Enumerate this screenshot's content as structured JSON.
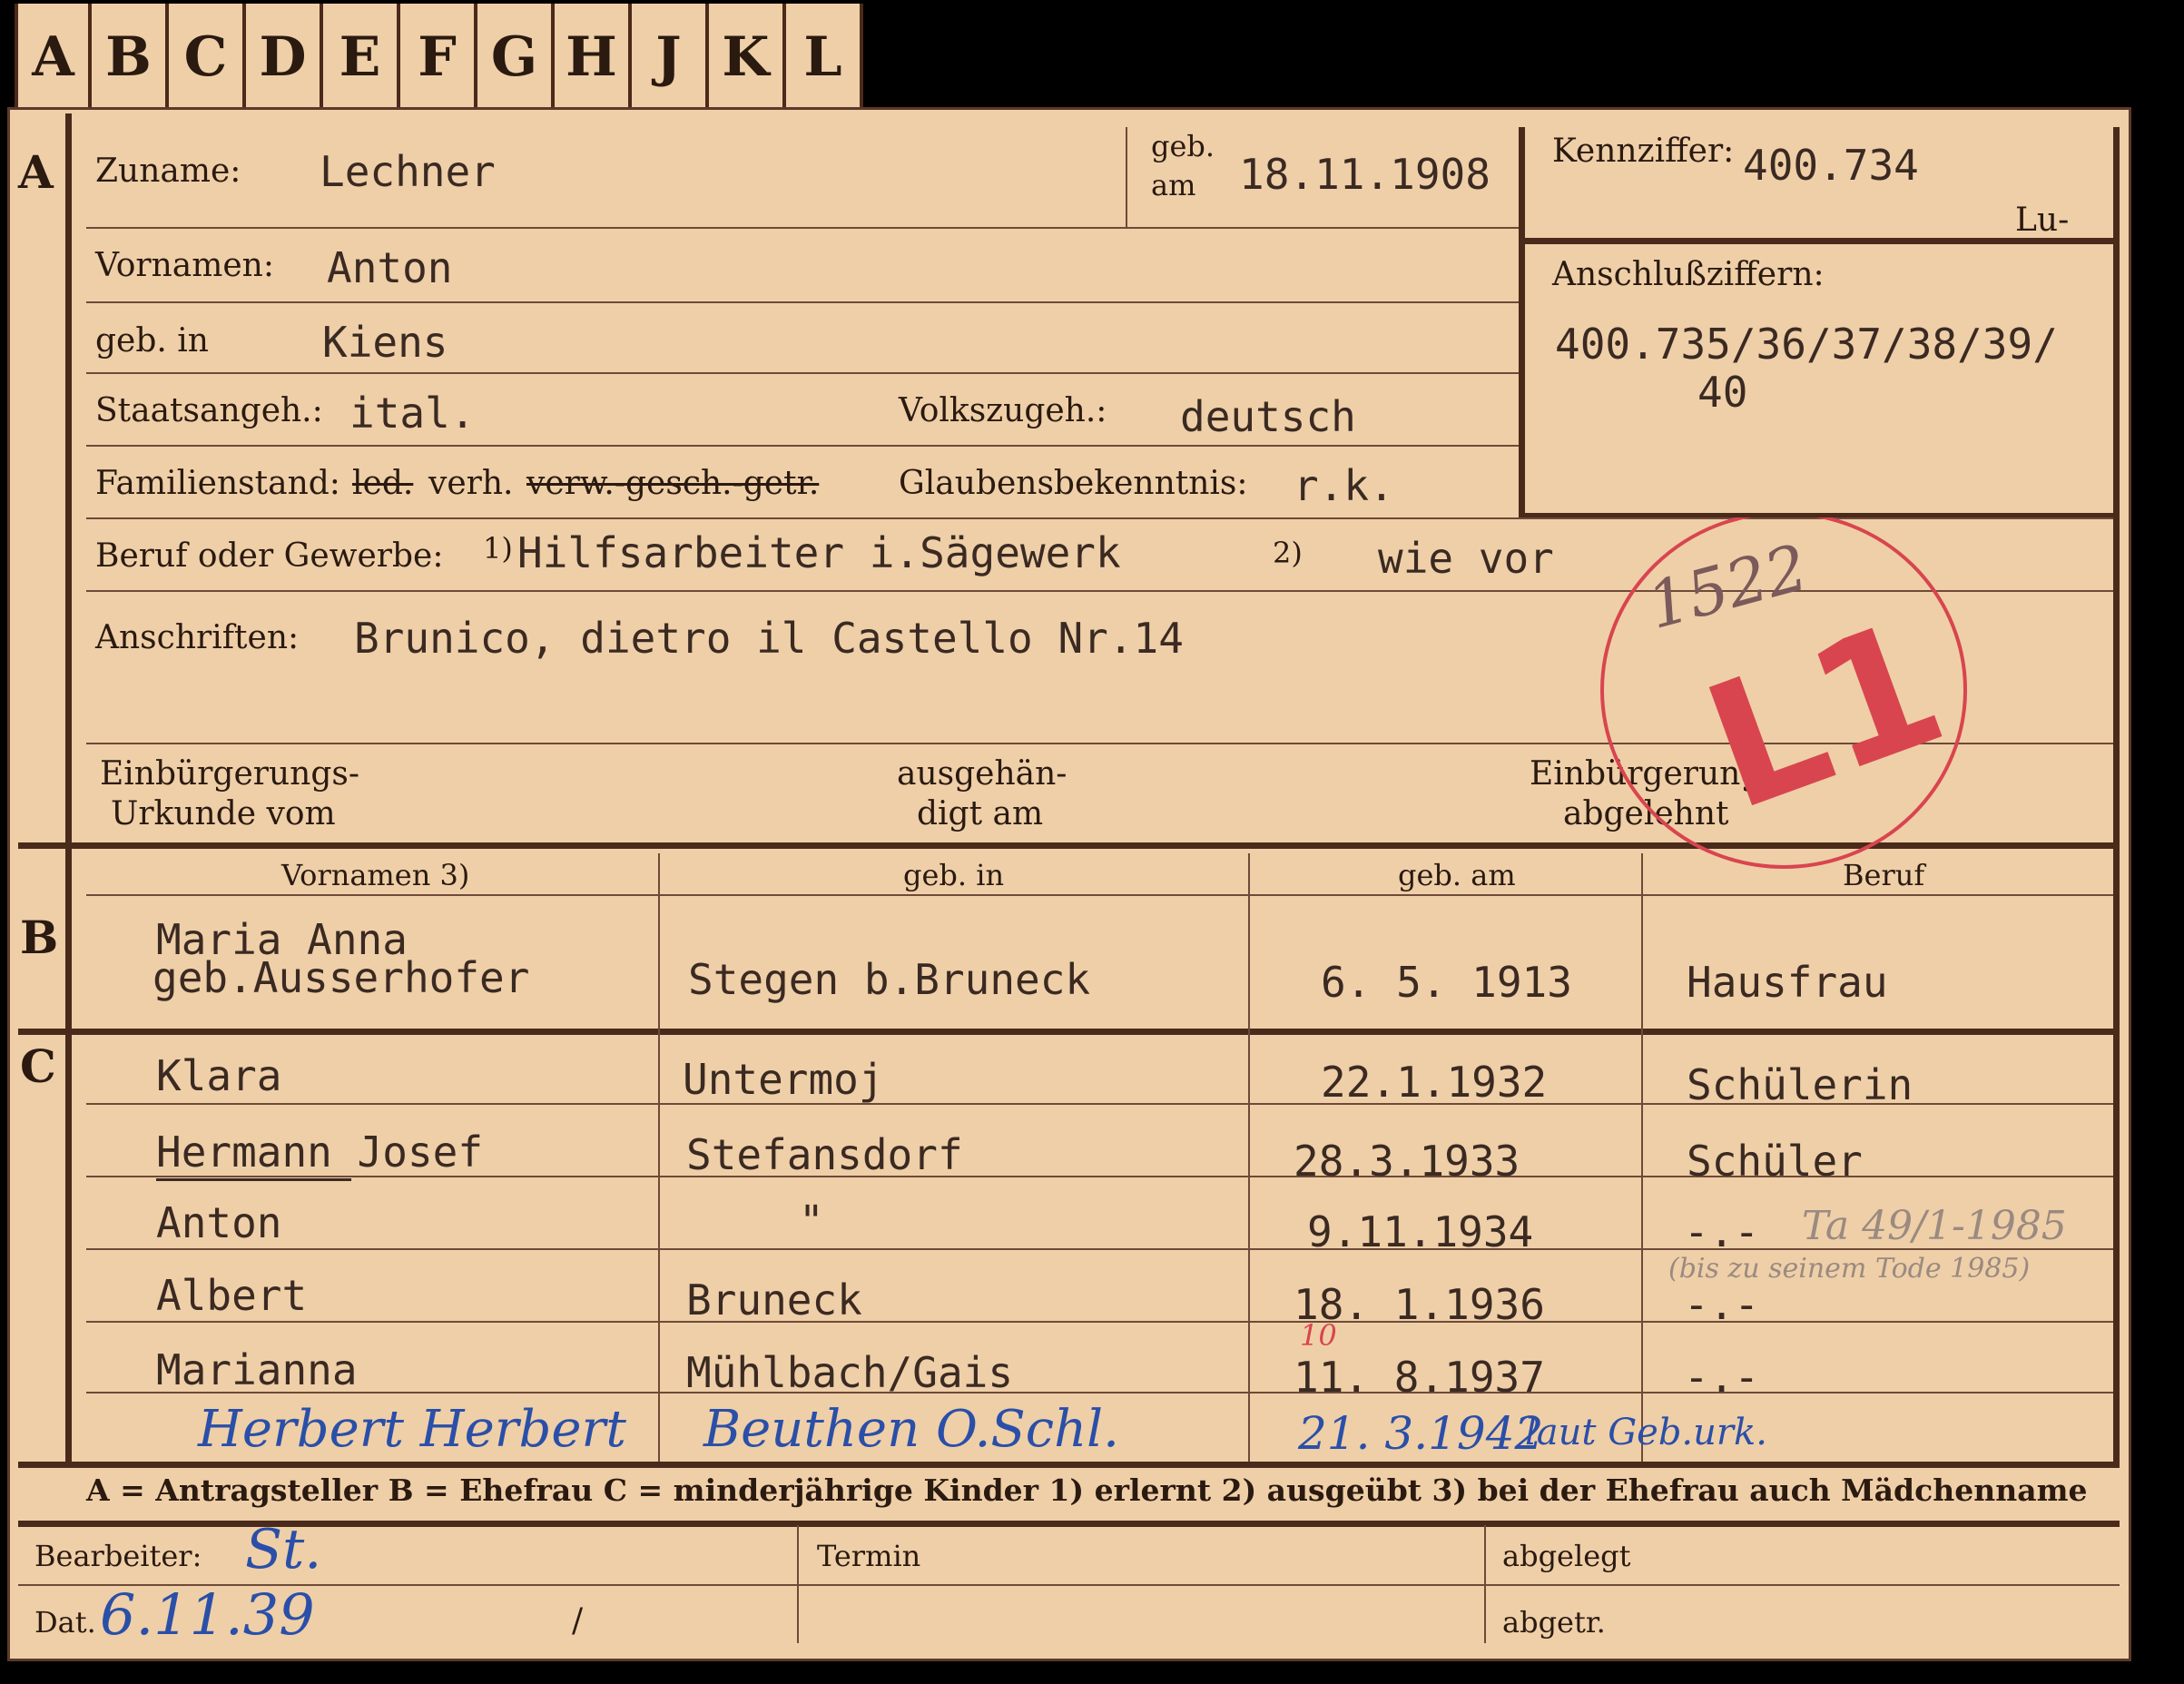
{
  "tabs": [
    "A",
    "B",
    "C",
    "D",
    "E",
    "F",
    "G",
    "H",
    "J",
    "K",
    "L"
  ],
  "sections": {
    "a": "A",
    "b": "B",
    "c": "C"
  },
  "header": {
    "zuname_label": "Zuname:",
    "zuname": "Lechner",
    "geb_label_1": "geb.",
    "geb_label_2": "am",
    "geb_am": "18.11.1908",
    "kennziffer_label": "Kennziffer:",
    "kennziffer": "400.734",
    "kennziffer_note": "Lu-",
    "anschluss_label": "Anschlußziffern:",
    "anschluss_1": "400.735/36/37/38/39/",
    "anschluss_2": "40",
    "vornamen_label": "Vornamen:",
    "vornamen": "Anton",
    "gebin_label": "geb. in",
    "gebin": "Kiens",
    "staat_label": "Staatsangeh.:",
    "staat": "ital.",
    "volk_label": "Volkszugeh.:",
    "volk": "deutsch",
    "fam_label": "Familienstand:",
    "fam_led": "led.",
    "fam_verh": "verh.",
    "fam_rest": "verw.-gesch.-getr.",
    "glaub_label": "Glaubensbekenntnis:",
    "glaub": "r.k.",
    "beruf_label": "Beruf oder Gewerbe:",
    "fn1": "1)",
    "beruf1": "Hilfsarbeiter i.Sägewerk",
    "fn2": "2)",
    "beruf2": "wie vor",
    "anschrift_label": "Anschriften:",
    "anschrift": "Brunico, dietro il Castello Nr.14",
    "einb1a": "Einbürgerungs-",
    "einb1b": "Urkunde vom",
    "ausg1": "ausgehän-",
    "ausg2": "digt am",
    "einb2a": "Einbürgerung",
    "einb2b": "abgelehnt"
  },
  "stamp": {
    "number": "1522",
    "code": "L1",
    "color": "#d8454f"
  },
  "spouse": {
    "headers": [
      "Vornamen 3)",
      "geb. in",
      "geb. am",
      "Beruf"
    ],
    "name1": "Maria Anna",
    "name2": "geb.Ausserhofer",
    "place": "Stegen b.Bruneck",
    "date": "6. 5. 1913",
    "job": "Hausfrau"
  },
  "children": [
    {
      "name": "Klara",
      "place": "Untermoj",
      "date": "22.1.1932",
      "job": "Schülerin"
    },
    {
      "name": "Hermann Josef",
      "place": "Stefansdorf",
      "date": "28.3.1933",
      "job": "Schüler"
    },
    {
      "name": "Anton",
      "place": "\"",
      "date": "9.11.1934",
      "job": "-.-"
    },
    {
      "name": "Albert",
      "place": "Bruneck",
      "date": "18. 1.1936",
      "job": "-.-"
    },
    {
      "name": "Marianna",
      "place": "Mühlbach/Gais",
      "date": "11. 8.1937",
      "job": "-.-"
    }
  ],
  "handwritten": {
    "child6_name": "Herbert Herbert",
    "child6_place": "Beuthen O.Schl.",
    "child6_date": "21. 3.1942",
    "child6_note": "laut Geb.urk.",
    "anton_note": "Ta 49/1-1985",
    "albert_note": "(bis zu seinem Tode 1985)",
    "date_correction": "10",
    "bearbeiter": "St.",
    "dat": "6.11.39"
  },
  "legend": "A = Antragsteller   B = Ehefrau   C = minderjährige Kinder   1) erlernt   2) ausgeübt   3) bei der Ehefrau auch Mädchenname",
  "footer": {
    "bearbeiter_label": "Bearbeiter:",
    "dat_label": "Dat.",
    "slash": "/",
    "termin_label": "Termin",
    "abgelegt_label": "abgelegt",
    "abgetr_label": "abgetr."
  },
  "colors": {
    "card": "#efcfa8",
    "ink_blue": "#2a4fa8",
    "stamp": "#d8454f",
    "rule": "#4a2a1a"
  }
}
